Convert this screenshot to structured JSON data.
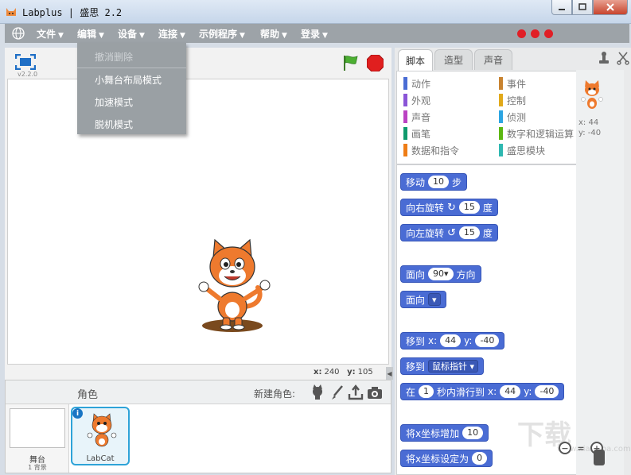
{
  "window": {
    "title": "Labplus | 盛思 2.2"
  },
  "menu": {
    "items": [
      {
        "label": "文件"
      },
      {
        "label": "编辑"
      },
      {
        "label": "设备"
      },
      {
        "label": "连接"
      },
      {
        "label": "示例程序"
      },
      {
        "label": "帮助"
      },
      {
        "label": "登录"
      }
    ],
    "status_colors": [
      "#e01f26",
      "#e01f26",
      "#e01f26"
    ]
  },
  "edit_dropdown": {
    "items": [
      {
        "label": "撤消删除",
        "enabled": false
      },
      {
        "label": "小舞台布局模式",
        "enabled": true
      },
      {
        "label": "加速模式",
        "enabled": true
      },
      {
        "label": "脱机模式",
        "enabled": true
      }
    ]
  },
  "stage": {
    "version": "v2.2.0",
    "coords": {
      "x_label": "x:",
      "x_value": "240",
      "y_label": "y:",
      "y_value": "105"
    }
  },
  "sprites": {
    "title": "角色",
    "new_sprite_label": "新建角色:",
    "stage_label": "舞台",
    "stage_backdrops": "1 背景",
    "items": [
      {
        "name": "LabCat"
      }
    ]
  },
  "tabs": [
    {
      "label": "脚本",
      "active": true
    },
    {
      "label": "造型",
      "active": false
    },
    {
      "label": "声音",
      "active": false
    }
  ],
  "categories": [
    {
      "label": "动作",
      "color": "#4a6cd4",
      "selected": true
    },
    {
      "label": "外观",
      "color": "#8a55d7",
      "selected": false
    },
    {
      "label": "声音",
      "color": "#bb42c3",
      "selected": false
    },
    {
      "label": "画笔",
      "color": "#0e9a6c",
      "selected": false
    },
    {
      "label": "数据和指令",
      "color": "#ee7d16",
      "selected": false
    },
    {
      "label": "事件",
      "color": "#c88330",
      "selected": false
    },
    {
      "label": "控制",
      "color": "#e1a91a",
      "selected": false
    },
    {
      "label": "侦测",
      "color": "#2ca5e2",
      "selected": false
    },
    {
      "label": "数字和逻辑运算",
      "color": "#5cb712",
      "selected": false
    },
    {
      "label": "盛思模块",
      "color": "#2eb8b1",
      "selected": false
    }
  ],
  "blocks": {
    "move": {
      "label": "移动",
      "value": "10",
      "suffix": "步"
    },
    "turn_right": {
      "label": "向右旋转",
      "value": "15",
      "suffix": "度"
    },
    "turn_left": {
      "label": "向左旋转",
      "value": "15",
      "suffix": "度"
    },
    "point_dir": {
      "label": "面向",
      "value": "90",
      "suffix": "方向"
    },
    "point_towards": {
      "label": "面向"
    },
    "goto_xy": {
      "label": "移到",
      "x_label": "x:",
      "x_value": "44",
      "y_label": "y:",
      "y_value": "-40"
    },
    "goto": {
      "label": "移到",
      "value": "鼠标指针"
    },
    "glide": {
      "label": "在",
      "value": "1",
      "middle": "秒内滑行到",
      "x_label": "x:",
      "x_value": "44",
      "y_label": "y:",
      "y_value": "-40"
    },
    "change_x": {
      "label": "将x坐标增加",
      "value": "10"
    },
    "set_x": {
      "label": "将x坐标设定为",
      "value": "0"
    }
  },
  "sprite_info": {
    "x": "x: 44",
    "y": "y: -40"
  },
  "watermark": {
    "main": "下载",
    "sub": "www.xiazaiba.com"
  }
}
